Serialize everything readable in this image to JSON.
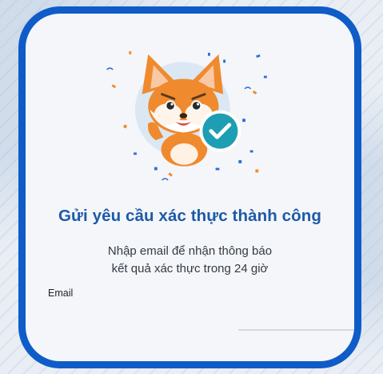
{
  "dialog": {
    "title": "Gửi yêu cầu xác thực thành công",
    "description_line1": "Nhập email để nhận thông báo",
    "description_line2": "kết quả xác thực trong 24 giờ"
  },
  "email": {
    "label": "Email",
    "value": "",
    "placeholder": ""
  },
  "colors": {
    "frame_blue": "#0f5cc9",
    "title_blue": "#1d5aa8",
    "check_teal": "#1e9eb2",
    "fox_orange": "#f08a2e"
  },
  "icons": {
    "mascot": "fox-mascot-icon",
    "success": "check-circle-icon",
    "decoration": "confetti-icon"
  }
}
